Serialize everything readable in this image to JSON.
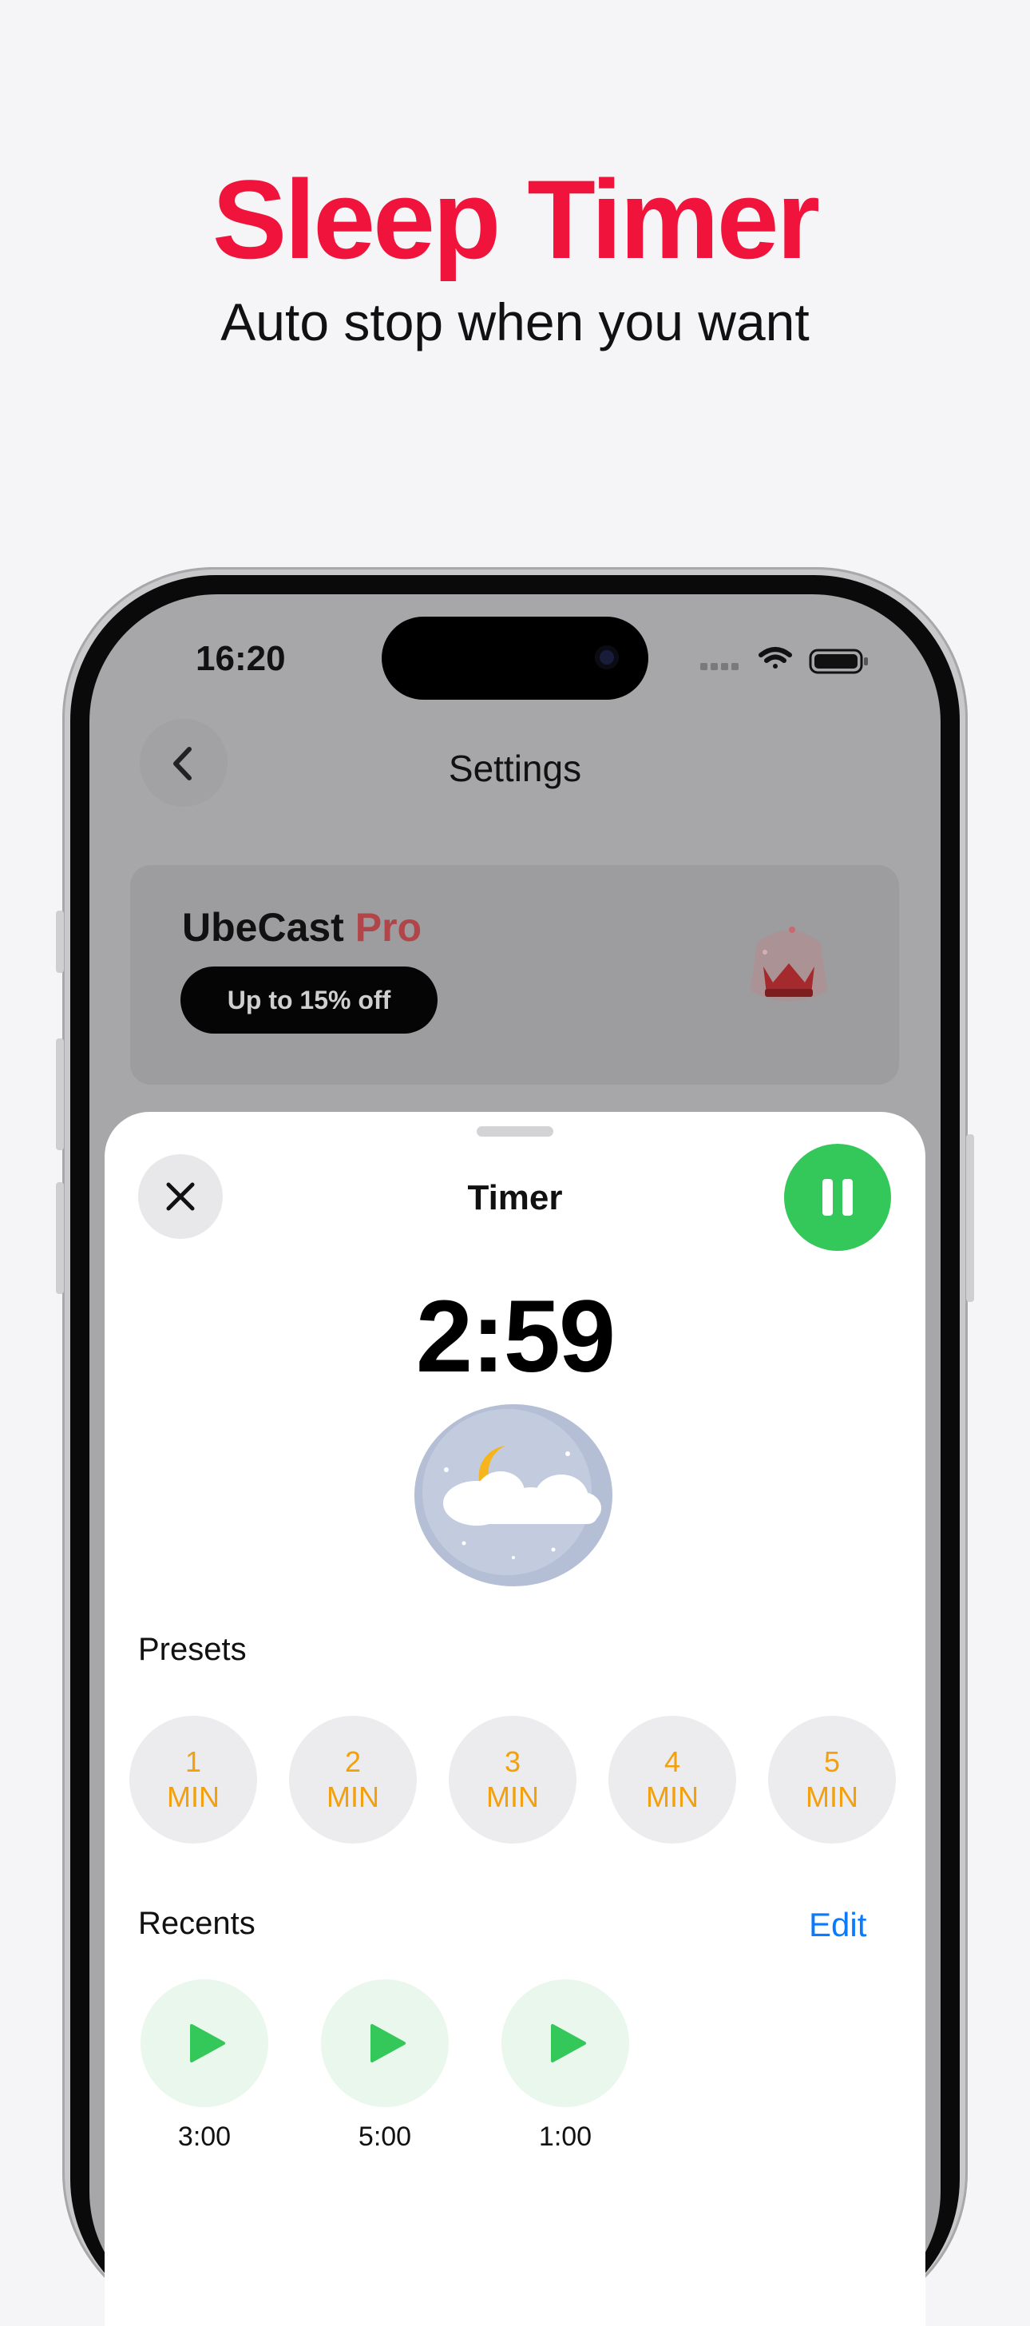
{
  "promo": {
    "headline": "Sleep Timer",
    "subline": "Auto stop when you want",
    "headline_color": "#f0143c"
  },
  "status_bar": {
    "time": "16:20"
  },
  "nav": {
    "title": "Settings"
  },
  "pro_card": {
    "title_main": "UbeCast",
    "title_accent": "Pro",
    "badge": "Up to 15% off"
  },
  "sheet": {
    "title": "Timer",
    "countdown": "2:59",
    "presets_label": "Presets",
    "presets": [
      {
        "number": "1",
        "unit": "MIN"
      },
      {
        "number": "2",
        "unit": "MIN"
      },
      {
        "number": "3",
        "unit": "MIN"
      },
      {
        "number": "4",
        "unit": "MIN"
      },
      {
        "number": "5",
        "unit": "MIN"
      }
    ],
    "recents_label": "Recents",
    "edit_label": "Edit",
    "recents": [
      {
        "label": "3:00"
      },
      {
        "label": "5:00"
      },
      {
        "label": "1:00"
      }
    ]
  },
  "colors": {
    "accent_red": "#f0143c",
    "play_green": "#34c759",
    "preset_orange": "#f2a00c",
    "link_blue": "#0a7aff"
  }
}
